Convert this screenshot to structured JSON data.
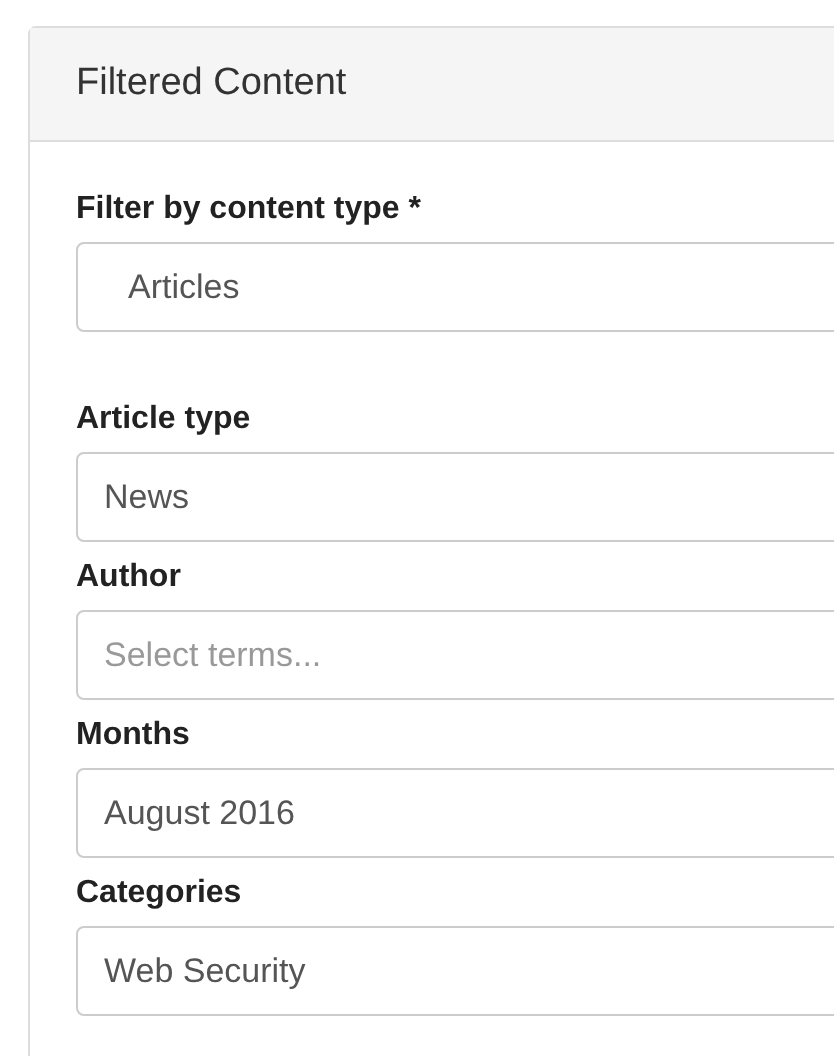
{
  "panel": {
    "title": "Filtered Content"
  },
  "fields": [
    {
      "label": "Filter by content type *",
      "kind": "select",
      "value": "Articles"
    },
    {
      "label": "Article type",
      "kind": "input",
      "value": "News"
    },
    {
      "label": "Author",
      "kind": "input",
      "placeholder": "Select terms..."
    },
    {
      "label": "Months",
      "kind": "input",
      "value": "August 2016"
    },
    {
      "label": "Categories",
      "kind": "input",
      "value": "Web Security"
    }
  ]
}
